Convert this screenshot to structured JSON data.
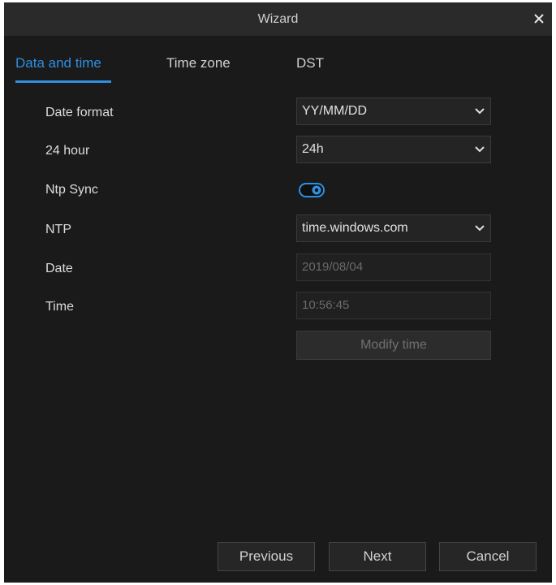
{
  "window": {
    "title": "Wizard"
  },
  "tabs": [
    {
      "label": "Data and time",
      "active": true
    },
    {
      "label": "Time zone",
      "active": false
    },
    {
      "label": "DST",
      "active": false
    }
  ],
  "form": {
    "date_format": {
      "label": "Date format",
      "value": "YY/MM/DD"
    },
    "hour_format": {
      "label": "24 hour",
      "value": "24h"
    },
    "ntp_sync": {
      "label": "Ntp Sync",
      "enabled": true
    },
    "ntp": {
      "label": "NTP",
      "value": "time.windows.com"
    },
    "date": {
      "label": "Date",
      "value": "2019/08/04"
    },
    "time": {
      "label": "Time",
      "value": "10:56:45"
    },
    "modify_label": "Modify time"
  },
  "footer": {
    "previous_label": "Previous",
    "next_label": "Next",
    "cancel_label": "Cancel"
  },
  "colors": {
    "accent": "#2f8fe0",
    "background": "#1a1a1a",
    "titlebar": "#2a2a2a"
  },
  "icons": {
    "close": "close-icon",
    "dropdown": "chevron-down-icon",
    "toggle": "toggle-switch-icon"
  }
}
